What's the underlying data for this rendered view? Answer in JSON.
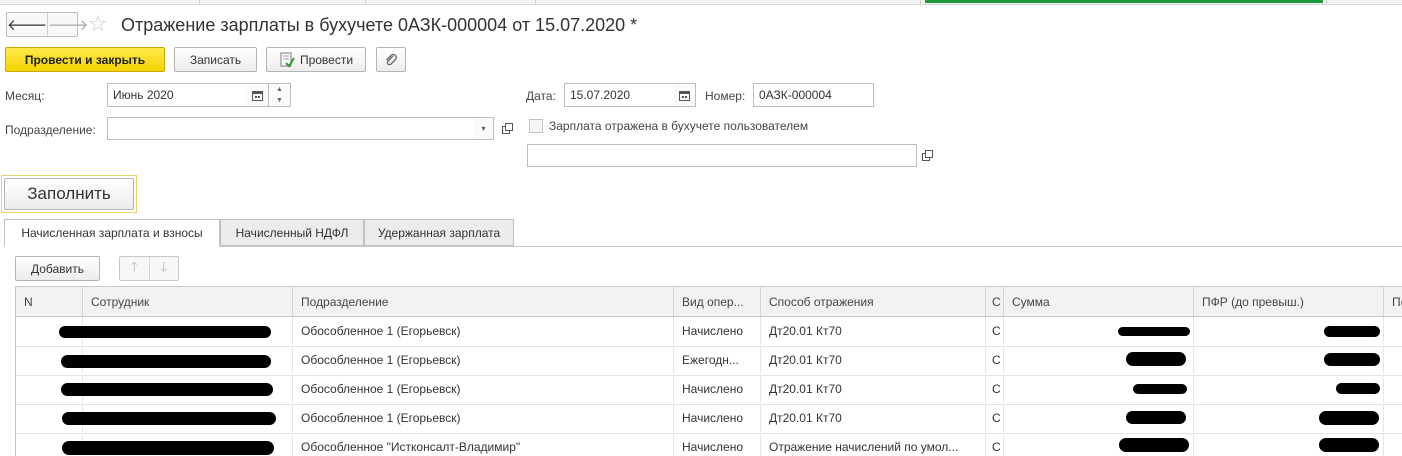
{
  "window": {
    "title": "Отражение зарплаты в бухучете 0АЗК-000004 от 15.07.2020 *",
    "nav_back": "🡐",
    "nav_forward": "🡒",
    "star": "☆"
  },
  "toolbar": {
    "post_close_label": "Провести и закрыть",
    "write_label": "Записать",
    "post_label": "Провести"
  },
  "form": {
    "month_label": "Месяц:",
    "month_value": "Июнь 2020",
    "date_label": "Дата:",
    "date_value": "15.07.2020",
    "number_label": "Номер:",
    "number_value": "0АЗК-000004",
    "division_label": "Подразделение:",
    "division_value": "",
    "reflected_label": "Зарплата отражена в бухучете пользователем",
    "reflected_checked": false,
    "user_value": ""
  },
  "fill_label": "Заполнить",
  "tabs": [
    {
      "label": "Начисленная зарплата и взносы",
      "active": true
    },
    {
      "label": "Начисленный НДФЛ",
      "active": false
    },
    {
      "label": "Удержанная зарплата",
      "active": false
    }
  ],
  "table": {
    "add_label": "Добавить",
    "columns": [
      "N",
      "Сотрудник",
      "Подразделение",
      "Вид опер...",
      "Способ отражения",
      "С",
      "Сумма",
      "ПФР (до превыш.)",
      "П("
    ],
    "rows": [
      {
        "division": "Обособленное 1 (Егорьевск)",
        "op": "Начислено",
        "method": "Дт20.01 Кт70",
        "c": "С"
      },
      {
        "division": "Обособленное 1 (Егорьевск)",
        "op": "Ежегодн...",
        "method": "Дт20.01 Кт70",
        "c": "С"
      },
      {
        "division": "Обособленное 1 (Егорьевск)",
        "op": "Начислено",
        "method": "Дт20.01 Кт70",
        "c": "С"
      },
      {
        "division": "Обособленное 1 (Егорьевск)",
        "op": "Начислено",
        "method": "Дт20.01 Кт70",
        "c": "С"
      },
      {
        "division": "Обособленное \"Истконсалт-Владимир\"",
        "op": "Начислено",
        "method": "Отражение начислений по умол...",
        "c": "С"
      }
    ]
  }
}
